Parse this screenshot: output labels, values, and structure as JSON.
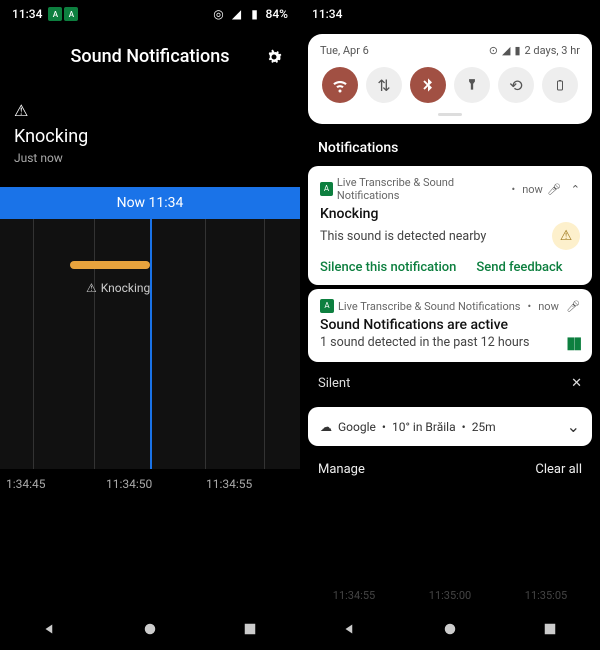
{
  "left": {
    "status": {
      "time": "11:34",
      "battery": "84%"
    },
    "header": {
      "title": "Sound Notifications"
    },
    "event": {
      "icon": "⚠",
      "title": "Knocking",
      "subtitle": "Just now"
    },
    "now_bar": "Now 11:34",
    "timeline_label": "Knocking",
    "axis": [
      "1:34:45",
      "11:34:50",
      "11:34:55"
    ]
  },
  "right": {
    "status": {
      "time": "11:34"
    },
    "qs": {
      "date": "Tue, Apr 6",
      "battery_text": "2 days, 3 hr",
      "tiles": [
        "wifi",
        "data",
        "bluetooth",
        "flashlight",
        "rotate",
        "battery-saver"
      ]
    },
    "section_label": "Notifications",
    "notif1": {
      "app": "Live Transcribe & Sound Notifications",
      "time": "now",
      "title": "Knocking",
      "body": "This sound is detected nearby",
      "action1": "Silence this notification",
      "action2": "Send feedback"
    },
    "notif2": {
      "app": "Live Transcribe & Sound Notifications",
      "time": "now",
      "title": "Sound Notifications are active",
      "body": "1 sound detected in the past 12 hours"
    },
    "silent_label": "Silent",
    "weather": {
      "source": "Google",
      "temp": "10° in Brăila",
      "age": "25m"
    },
    "manage": "Manage",
    "clear": "Clear all",
    "ghost_axis": [
      "11:34:55",
      "11:35:00",
      "11:35:05"
    ]
  }
}
